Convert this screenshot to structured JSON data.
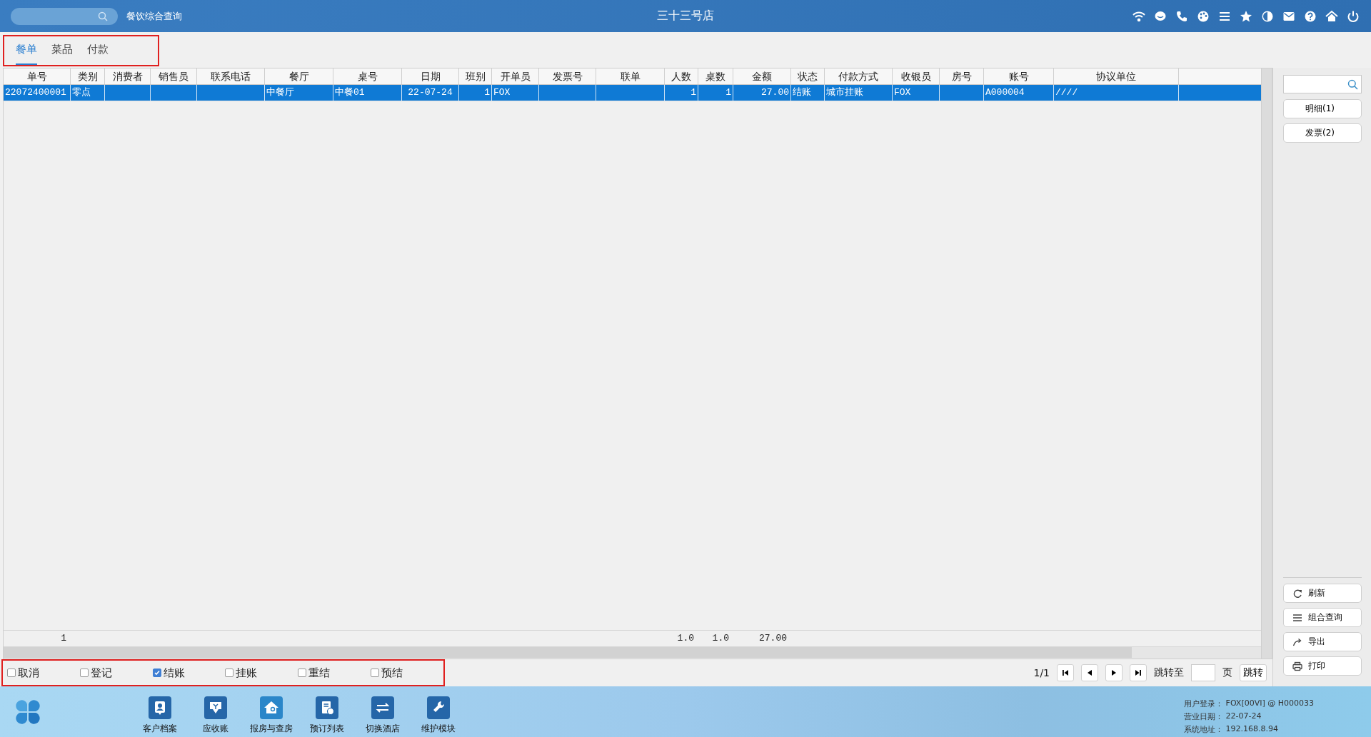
{
  "window": {
    "title": "三十三号店",
    "module": "餐饮综合查询"
  },
  "tabs": [
    {
      "label": "餐单",
      "selected": true
    },
    {
      "label": "菜品",
      "selected": false
    },
    {
      "label": "付款",
      "selected": false
    }
  ],
  "table": {
    "columns": [
      {
        "label": "单号"
      },
      {
        "label": "类别"
      },
      {
        "label": "消费者"
      },
      {
        "label": "销售员"
      },
      {
        "label": "联系电话"
      },
      {
        "label": "餐厅"
      },
      {
        "label": "桌号"
      },
      {
        "label": "日期"
      },
      {
        "label": "班别"
      },
      {
        "label": "开单员"
      },
      {
        "label": "发票号"
      },
      {
        "label": "联单"
      },
      {
        "label": "人数"
      },
      {
        "label": "桌数"
      },
      {
        "label": "金额"
      },
      {
        "label": "状态"
      },
      {
        "label": "付款方式"
      },
      {
        "label": "收银员"
      },
      {
        "label": "房号"
      },
      {
        "label": "账号"
      },
      {
        "label": "协议单位"
      }
    ],
    "rows": [
      {
        "selected": true,
        "cells": {
          "order_no": "22072400001",
          "category": "零点",
          "restaurant": "中餐厅",
          "table": "中餐01",
          "date": "22-07-24",
          "shift": "1",
          "opener": "FOX",
          "guests": "1",
          "tables": "1",
          "amount": "27.00",
          "status": "结账",
          "payment_method": "城市挂账",
          "cashier": "FOX",
          "account": "A000004",
          "partner_unit": "////"
        }
      }
    ],
    "totals": {
      "order_no": "1",
      "guests": "1.0",
      "tables": "1.0",
      "amount": "27.00"
    }
  },
  "status_filters": [
    {
      "label": "取消",
      "checked": false
    },
    {
      "label": "登记",
      "checked": false
    },
    {
      "label": "结账",
      "checked": true
    },
    {
      "label": "挂账",
      "checked": false
    },
    {
      "label": "重结",
      "checked": false
    },
    {
      "label": "预结",
      "checked": false
    }
  ],
  "pager": {
    "page": "1/1",
    "goto_label": "跳转至",
    "page_unit": "页",
    "goto_button": "跳转"
  },
  "side_panel": {
    "top_buttons": [
      "明细(1)",
      "发票(2)"
    ],
    "bottom_buttons": [
      "刷新",
      "组合查询",
      "导出",
      "打印"
    ]
  },
  "dock": {
    "items": [
      "客户档案",
      "应收账",
      "报房与查房",
      "预订列表",
      "切换酒店",
      "维护模块"
    ]
  },
  "status_info": [
    {
      "label": "用户登录：",
      "value": "FOX[00VI] @ H000033"
    },
    {
      "label": "营业日期：",
      "value": "22-07-24"
    },
    {
      "label": "系统地址：",
      "value": "192.168.8.94"
    }
  ]
}
